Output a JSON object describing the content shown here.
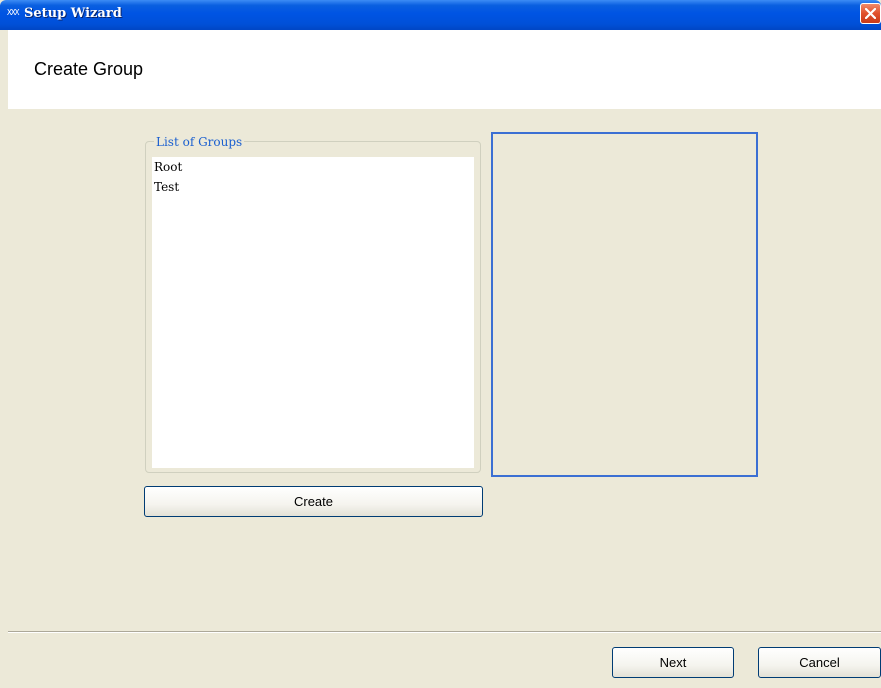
{
  "window": {
    "title": "Setup Wizard",
    "icon_text": "XXX",
    "icon": "app-icon",
    "close_icon": "close-icon"
  },
  "header": {
    "title": "Create Group"
  },
  "group_list": {
    "legend": "List of Groups",
    "items": [
      "Root",
      "Test"
    ]
  },
  "buttons": {
    "create_label": "Create",
    "next_label": "Next",
    "cancel_label": "Cancel"
  },
  "colors": {
    "titlebar": "#0054e3",
    "background": "#ece9d8",
    "legend_text": "#1a5fd0",
    "panel_border": "#3b6fd3",
    "close_button": "#e0502c"
  }
}
